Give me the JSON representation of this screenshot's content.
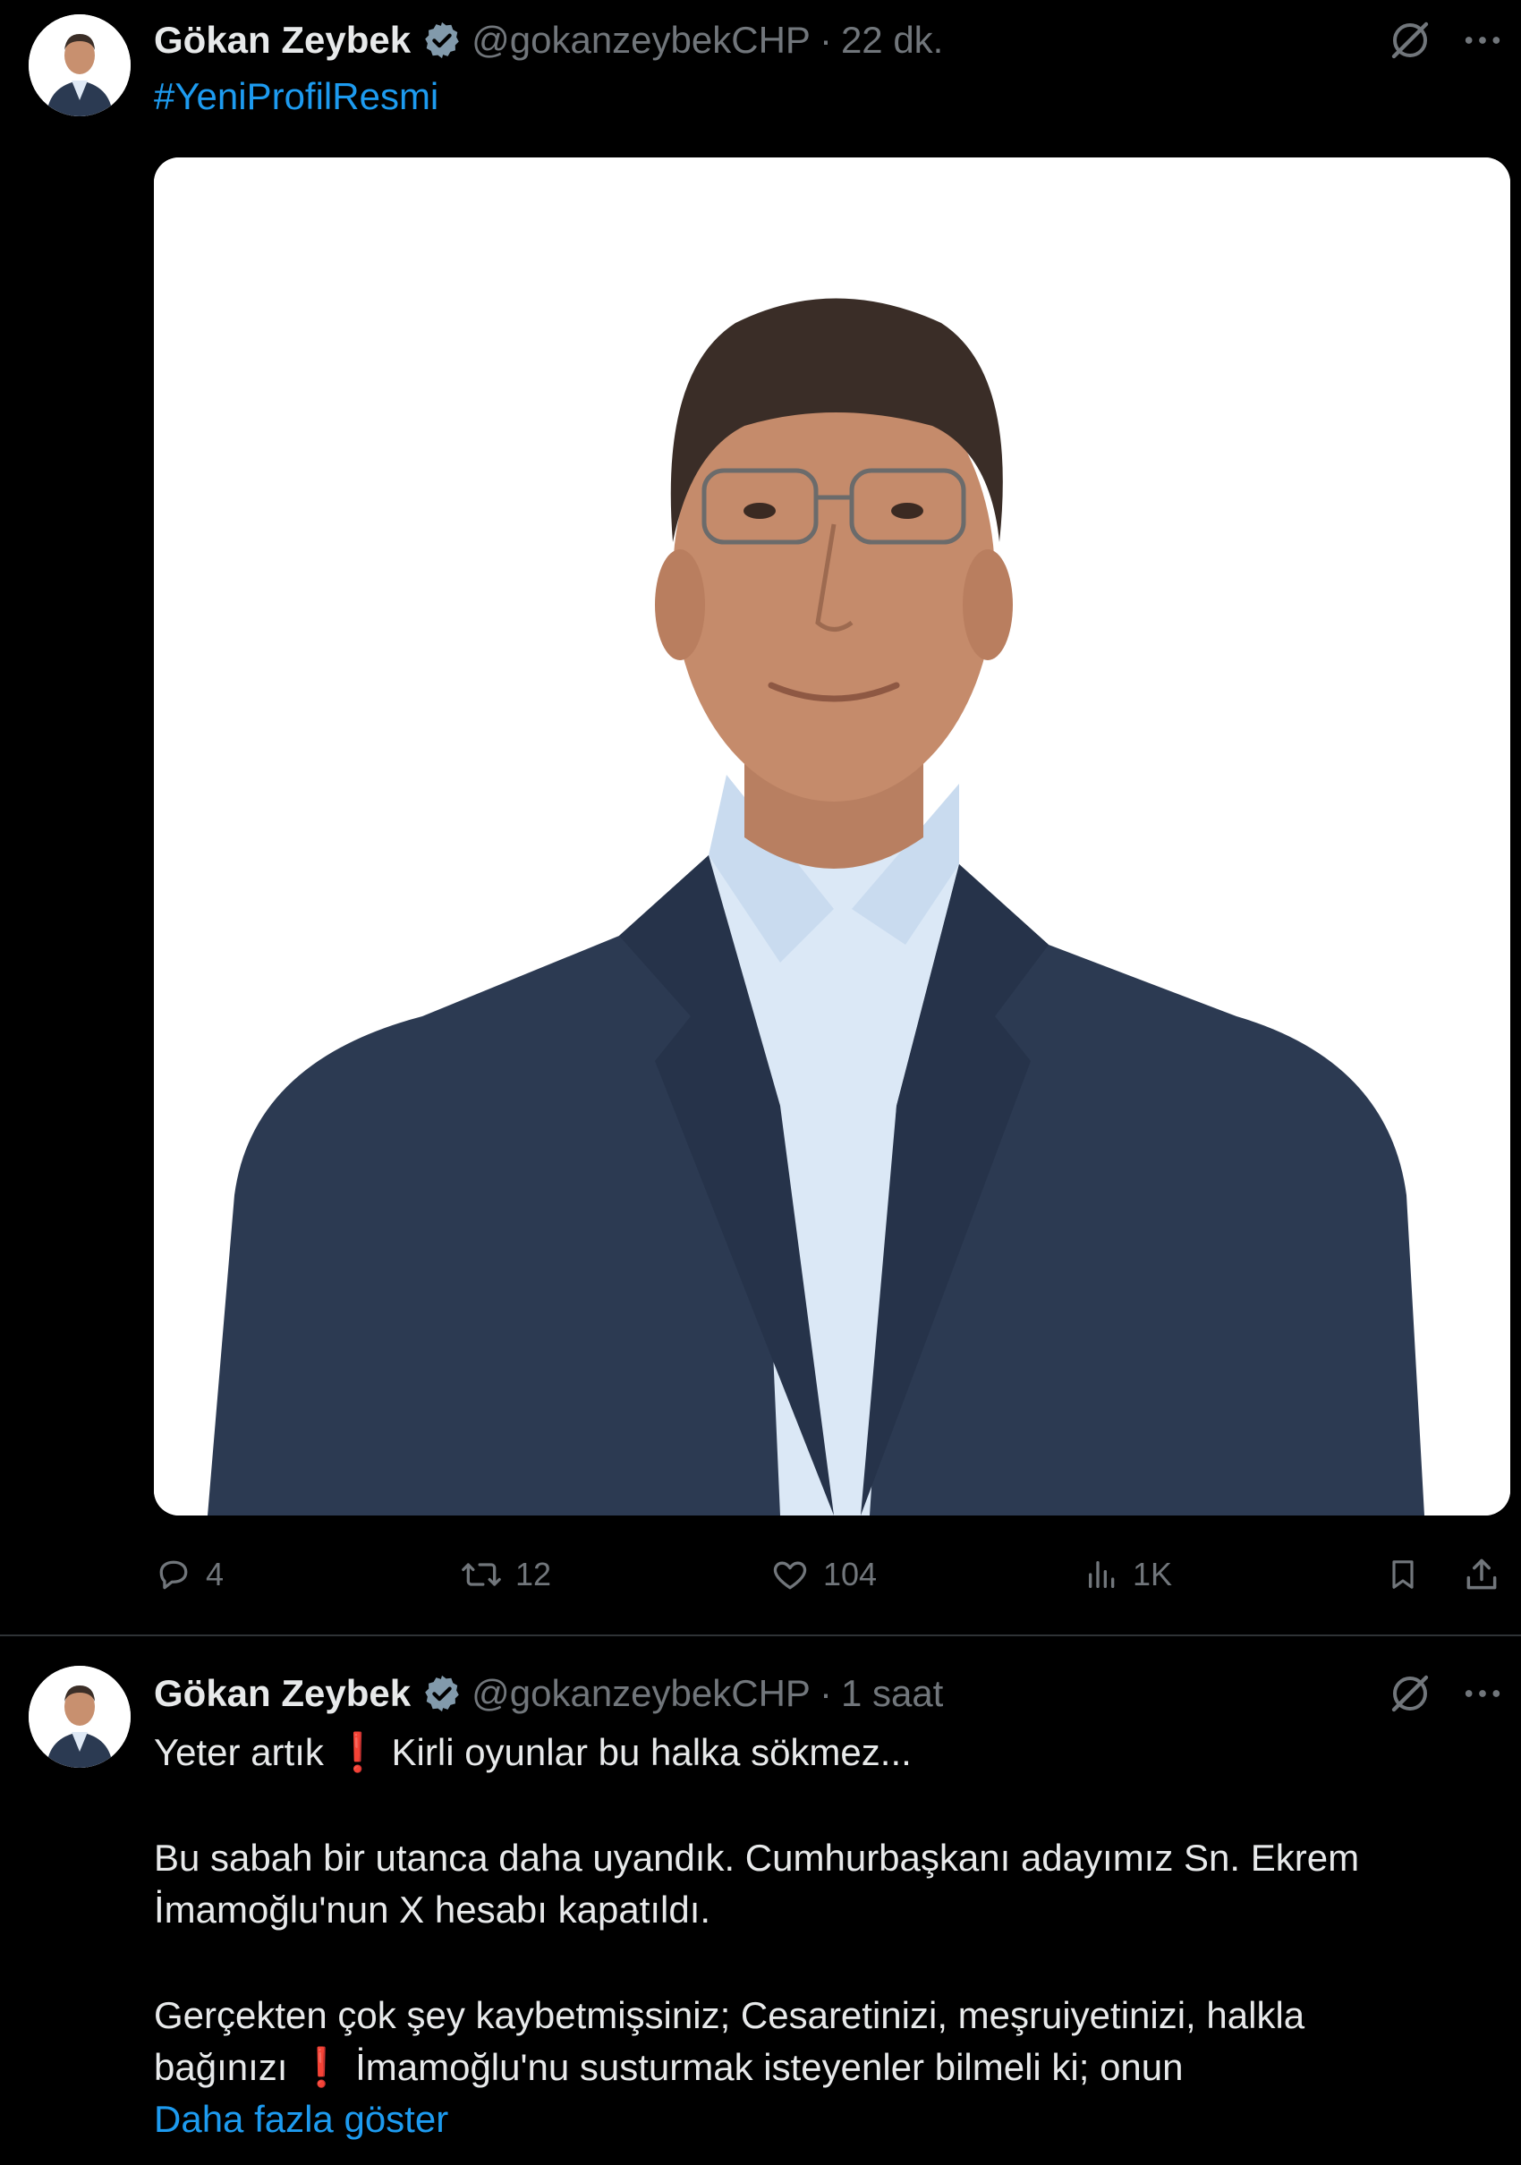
{
  "tweets": [
    {
      "author": {
        "name": "Gökan Zeybek",
        "handle": "@gokanzeybekCHP",
        "separator": "·",
        "time": "22 dk."
      },
      "text": {
        "hashtag": "#YeniProfilResmi"
      },
      "stats": {
        "replies": "4",
        "reposts": "12",
        "likes": "104",
        "views": "1K"
      }
    },
    {
      "author": {
        "name": "Gökan Zeybek",
        "handle": "@gokanzeybekCHP",
        "separator": "·",
        "time": "1 saat"
      },
      "text": {
        "line1_a": "Yeter artık",
        "line1_b": "Kirli oyunlar bu halka sökmez...",
        "line2a": "Bu sabah bir utanca daha uyandık. Cumhurbaşkanı adayımız Sn. Ekrem",
        "line2b": "İmamoğlu'nun X hesabı kapatıldı.",
        "line3a": "Gerçekten çok şey kaybetmişsiniz; Cesaretinizi, meşruiyetinizi, halkla",
        "line3b_a": "bağınızı",
        "line3b_b": "İmamoğlu'nu susturmak isteyenler bilmeli ki; onun",
        "show_more": "Daha fazla göster"
      }
    }
  ],
  "theme": {
    "background": "#000000",
    "text": "#e7e9ea",
    "muted": "#71767b",
    "accent": "#1d9bf0",
    "verified": "#829aab"
  },
  "icons": [
    "verified-badge-icon",
    "grok-icon",
    "more-icon",
    "reply-icon",
    "repost-icon",
    "like-icon",
    "views-icon",
    "bookmark-icon",
    "share-icon",
    "exclamation-icon"
  ]
}
